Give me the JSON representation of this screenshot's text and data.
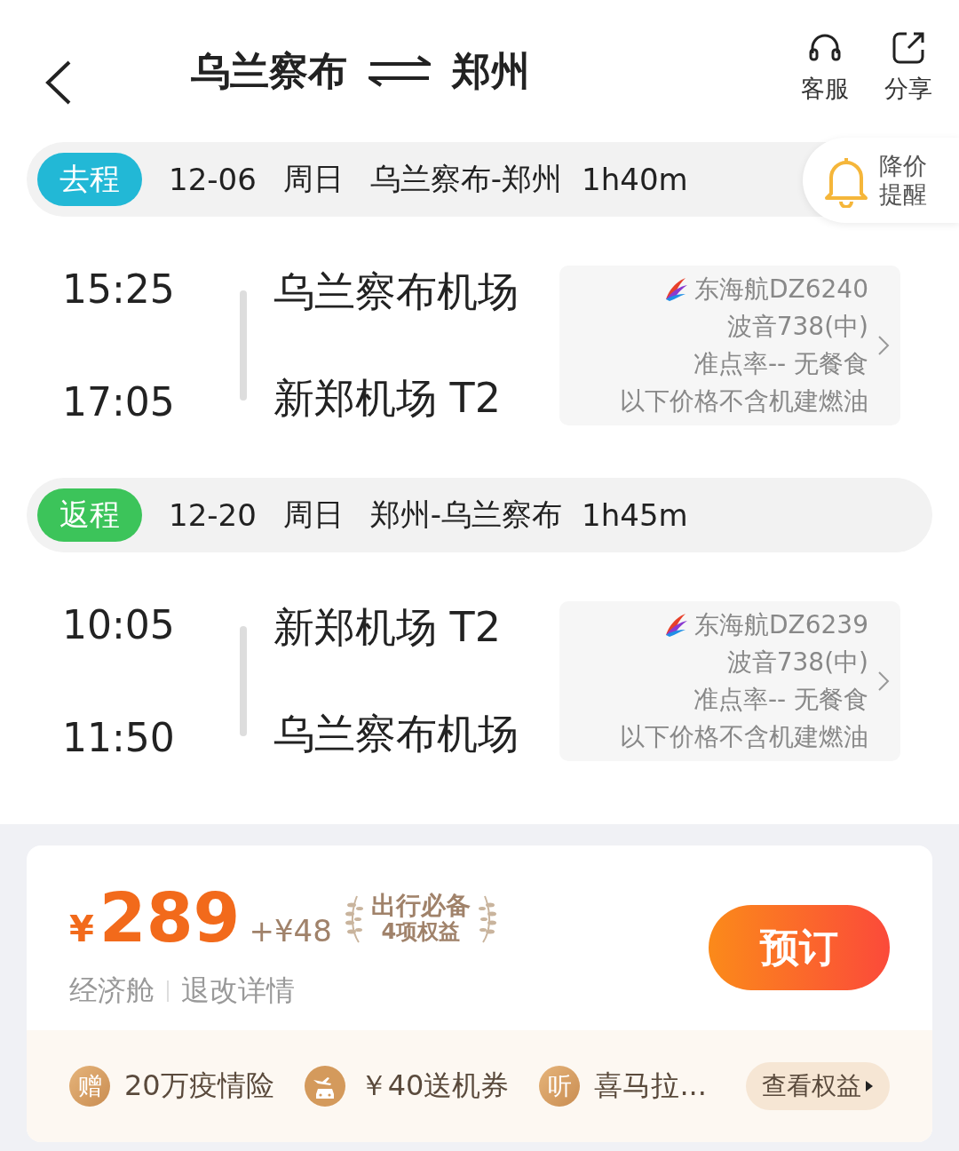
{
  "header": {
    "from": "乌兰察布",
    "to": "郑州",
    "actions": [
      {
        "kind": "service",
        "label": "客服"
      },
      {
        "kind": "share",
        "label": "分享"
      }
    ]
  },
  "price_alert": {
    "line1": "降价",
    "line2": "提醒"
  },
  "legs": [
    {
      "tag": "去程",
      "color": "#22b8d6",
      "date": "12-06",
      "weekday": "周日",
      "route": "乌兰察布-郑州",
      "duration": "1h40m",
      "depart_time": "15:25",
      "depart_airport": "乌兰察布机场",
      "arrive_time": "17:05",
      "arrive_airport": "新郑机场 T2",
      "flight": {
        "airline": "东海航DZ6240",
        "aircraft": "波音738(中)",
        "punctuality": "准点率-- 无餐食",
        "note": "以下价格不含机建燃油"
      }
    },
    {
      "tag": "返程",
      "color": "#3cc45a",
      "date": "12-20",
      "weekday": "周日",
      "route": "郑州-乌兰察布",
      "duration": "1h45m",
      "depart_time": "10:05",
      "depart_airport": "新郑机场 T2",
      "arrive_time": "11:50",
      "arrive_airport": "乌兰察布机场",
      "flight": {
        "airline": "东海航DZ6239",
        "aircraft": "波音738(中)",
        "punctuality": "准点率-- 无餐食",
        "note": "以下价格不含机建燃油"
      }
    }
  ],
  "offer": {
    "currency": "¥",
    "price": "289",
    "addon": "+¥48",
    "badge_title": "出行必备",
    "badge_subtitle": "4项权益",
    "cabin": "经济舱",
    "rules_link": "退改详情",
    "book_button": "预订",
    "perks": [
      {
        "kind": "glyph",
        "glyph": "赠",
        "label": "20万疫情险"
      },
      {
        "kind": "plane-car",
        "label": "￥40送机券"
      },
      {
        "kind": "glyph",
        "glyph": "听",
        "label": "喜马拉..."
      }
    ],
    "benefits_button": "查看权益"
  }
}
